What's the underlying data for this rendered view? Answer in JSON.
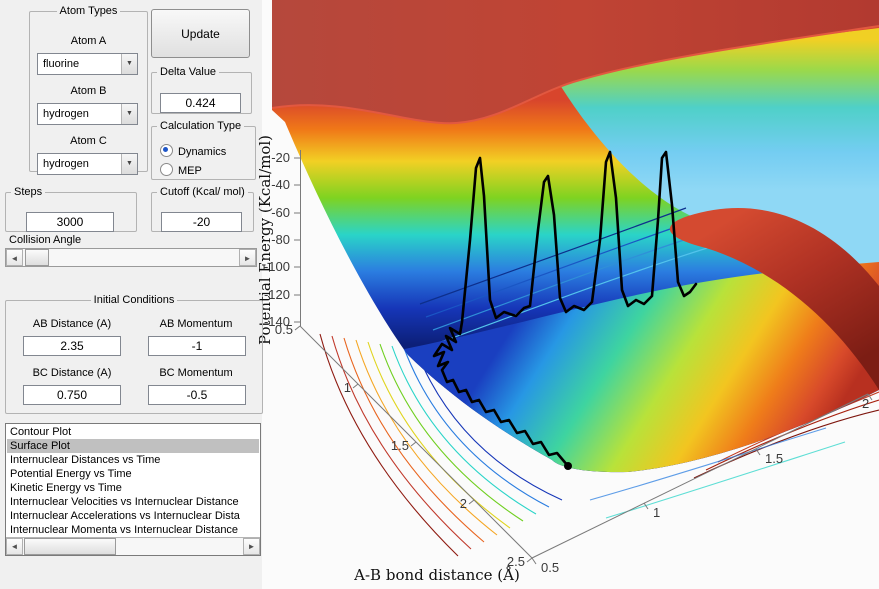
{
  "window": {
    "background": "#f0f0f0"
  },
  "icons": {
    "combo_arrow": "▼",
    "arrow_left": "◄",
    "arrow_right": "►"
  },
  "colors": {
    "list_selection": "#c0c0c0",
    "radio_dot": "#1e56c8",
    "trajectory": "#000000"
  },
  "atom_types": {
    "title": "Atom Types",
    "a": {
      "label": "Atom A",
      "value": "fluorine"
    },
    "b": {
      "label": "Atom B",
      "value": "hydrogen"
    },
    "c": {
      "label": "Atom C",
      "value": "hydrogen"
    }
  },
  "update": {
    "label": "Update"
  },
  "delta": {
    "title": "Delta Value",
    "value": "0.424"
  },
  "calculation_type": {
    "title": "Calculation Type",
    "dynamics": "Dynamics",
    "mep": "MEP",
    "selected": "Dynamics"
  },
  "steps": {
    "title": "Steps",
    "value": "3000"
  },
  "cutoff": {
    "title": "Cutoff (Kcal/ mol)",
    "value": "-20"
  },
  "collision_angle": {
    "label": "Collision Angle"
  },
  "initial_conditions": {
    "title": "Initial Conditions",
    "ab_distance": {
      "label": "AB Distance (A)",
      "value": "2.35"
    },
    "ab_momentum": {
      "label": "AB Momentum",
      "value": "-1"
    },
    "bc_distance": {
      "label": "BC Distance (A)",
      "value": "0.750"
    },
    "bc_momentum": {
      "label": "BC Momentum",
      "value": "-0.5"
    }
  },
  "plot_list": {
    "items": [
      "Contour Plot",
      "Surface Plot",
      "Internuclear Distances vs Time",
      "Potential Energy vs Time",
      "Kinetic Energy vs Time",
      "Internuclear Velocities vs Internuclear Distance",
      "Internuclear Accelerations vs Internuclear Dista",
      "Internuclear Momenta vs Internuclear Distance"
    ],
    "selected": "Surface Plot",
    "selected_index": 1
  },
  "chart_data": {
    "type": "surface",
    "colormap": "jet",
    "xlabel": "A-B bond distance (Å)",
    "zlabel": "Potential Energy (Kcal/mol)",
    "x_ticks": [
      "0.5",
      "1",
      "1.5",
      "2",
      "2.5"
    ],
    "y_ticks": [
      "0.5",
      "1",
      "1.5",
      "2"
    ],
    "z_ticks": [
      "-20",
      "-40",
      "-60",
      "-80",
      "-100",
      "-120",
      "-140"
    ],
    "x_range": [
      0.5,
      2.5
    ],
    "y_range": [
      0.5,
      2
    ],
    "z_range": [
      -140,
      -20
    ]
  }
}
